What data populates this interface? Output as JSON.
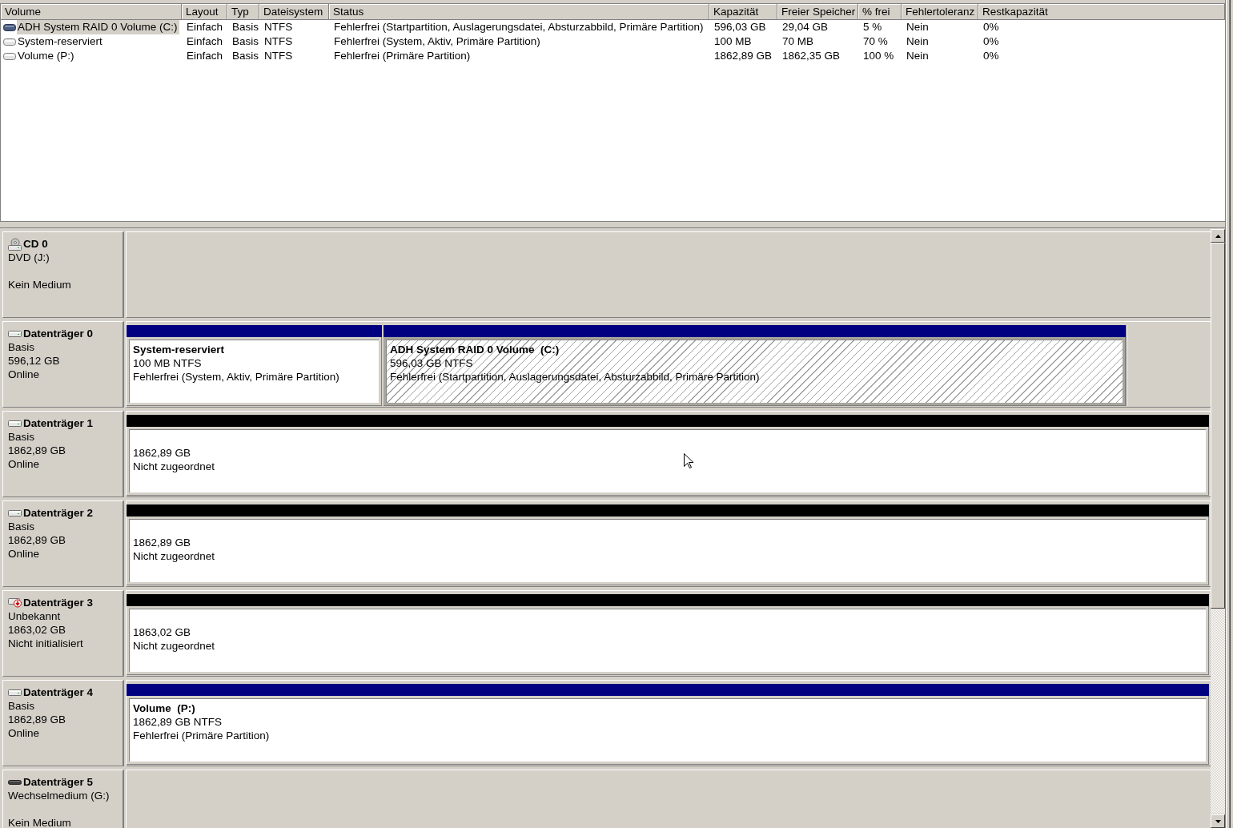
{
  "volume_list": {
    "columns": [
      "Volume",
      "Layout",
      "Typ",
      "Dateisystem",
      "Status",
      "Kapazität",
      "Freier Speicher",
      "% frei",
      "Fehlertoleranz",
      "Restkapazität"
    ],
    "rows": [
      {
        "selected": true,
        "cells": [
          "ADH System RAID 0 Volume (C:)",
          "Einfach",
          "Basis",
          "NTFS",
          "Fehlerfrei (Startpartition, Auslagerungsdatei, Absturzabbild, Primäre Partition)",
          "596,03 GB",
          "29,04 GB",
          "5 %",
          "Nein",
          "0%"
        ]
      },
      {
        "selected": false,
        "cells": [
          "System-reserviert",
          "Einfach",
          "Basis",
          "NTFS",
          "Fehlerfrei (System, Aktiv, Primäre Partition)",
          "100 MB",
          "70 MB",
          "70 %",
          "Nein",
          "0%"
        ]
      },
      {
        "selected": false,
        "cells": [
          "Volume (P:)",
          "Einfach",
          "Basis",
          "NTFS",
          "Fehlerfrei (Primäre Partition)",
          "1862,89 GB",
          "1862,35 GB",
          "100 %",
          "Nein",
          "0%"
        ]
      }
    ]
  },
  "disks": [
    {
      "kind": "cd",
      "name": "CD 0",
      "type": "DVD (J:)",
      "status": "Kein Medium"
    },
    {
      "kind": "disk",
      "name": "Datenträger 0",
      "type": "Basis",
      "size": "596,12 GB",
      "status": "Online",
      "partitions": [
        {
          "kind": "primary",
          "selected": false,
          "name": "System-reserviert",
          "size": "100 MB NTFS",
          "status": "Fehlerfrei (System, Aktiv, Primäre Partition)"
        },
        {
          "kind": "primary",
          "selected": true,
          "name": "ADH System RAID 0 Volume  (C:)",
          "size": "596,03 GB NTFS",
          "status": "Fehlerfrei (Startpartition, Auslagerungsdatei, Absturzabbild, Primäre Partition)"
        }
      ]
    },
    {
      "kind": "disk",
      "name": "Datenträger 1",
      "type": "Basis",
      "size": "1862,89 GB",
      "status": "Online",
      "partitions": [
        {
          "kind": "unallocated",
          "selected": false,
          "size": "1862,89 GB",
          "status": "Nicht zugeordnet"
        }
      ]
    },
    {
      "kind": "disk",
      "name": "Datenträger 2",
      "type": "Basis",
      "size": "1862,89 GB",
      "status": "Online",
      "partitions": [
        {
          "kind": "unallocated",
          "selected": false,
          "size": "1862,89 GB",
          "status": "Nicht zugeordnet"
        }
      ]
    },
    {
      "kind": "uninitialized",
      "name": "Datenträger 3",
      "type": "Unbekannt",
      "size": "1863,02 GB",
      "status": "Nicht initialisiert",
      "partitions": [
        {
          "kind": "unallocated",
          "selected": false,
          "size": "1863,02 GB",
          "status": "Nicht zugeordnet"
        }
      ]
    },
    {
      "kind": "disk",
      "name": "Datenträger 4",
      "type": "Basis",
      "size": "1862,89 GB",
      "status": "Online",
      "partitions": [
        {
          "kind": "primary",
          "selected": false,
          "name": "Volume  (P:)",
          "size": "1862,89 GB NTFS",
          "status": "Fehlerfrei (Primäre Partition)"
        }
      ]
    },
    {
      "kind": "removable",
      "name": "Datenträger 5",
      "type": "Wechselmedium (G:)",
      "status": "Kein Medium"
    }
  ]
}
